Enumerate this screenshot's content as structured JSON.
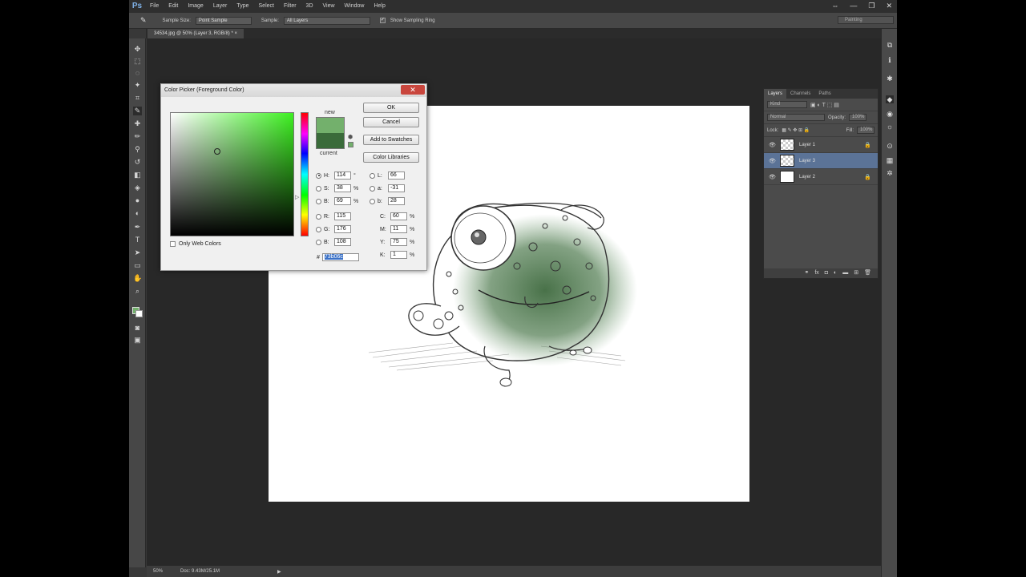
{
  "app": {
    "logo": "Ps"
  },
  "menu": [
    "File",
    "Edit",
    "Image",
    "Layer",
    "Type",
    "Select",
    "Filter",
    "3D",
    "View",
    "Window",
    "Help"
  ],
  "window_controls": [
    "⇔",
    "—",
    "❐",
    "✕"
  ],
  "options_bar": {
    "sample_size_label": "Sample Size:",
    "sample_size_value": "Point Sample",
    "sample_label": "Sample:",
    "sample_value": "All Layers",
    "show_ring_label": "Show Sampling Ring",
    "workspace": "Painting"
  },
  "document_tab": "34534.jpg @ 50% (Layer 3, RGB/8) *",
  "status": {
    "zoom": "50%",
    "doc": "Doc: 9.43M/25.1M"
  },
  "color_picker": {
    "title": "Color Picker (Foreground Color)",
    "new_label": "new",
    "current_label": "current",
    "new_color": "#73b06c",
    "current_color": "#3a6b3a",
    "buttons": {
      "ok": "OK",
      "cancel": "Cancel",
      "add_swatches": "Add to Swatches",
      "libraries": "Color Libraries"
    },
    "hsb": {
      "h": "114",
      "s": "38",
      "b": "69",
      "h_unit": "°",
      "s_unit": "%",
      "b_unit": "%"
    },
    "rgb": {
      "r": "115",
      "g": "176",
      "b": "108"
    },
    "lab": {
      "l": "66",
      "a": "-31",
      "b": "28"
    },
    "cmyk": {
      "c": "60",
      "m": "11",
      "y": "75",
      "k": "1"
    },
    "hex": "73b06c",
    "only_web": "Only Web Colors",
    "labels": {
      "h": "H:",
      "s": "S:",
      "b": "B:",
      "r": "R:",
      "g": "G:",
      "bb": "B:",
      "l": "L:",
      "a": "a:",
      "lab_b": "b:",
      "c": "C:",
      "m": "M:",
      "y": "Y:",
      "k": "K:",
      "hash": "#",
      "pct": "%"
    }
  },
  "layers_panel": {
    "tabs": [
      "Layers",
      "Channels",
      "Paths"
    ],
    "kind": "Kind",
    "blend_mode": "Normal",
    "opacity_label": "Opacity:",
    "opacity_value": "100%",
    "lock_label": "Lock:",
    "fill_label": "Fill:",
    "fill_value": "100%",
    "layers": [
      {
        "name": "Layer 1",
        "selected": false,
        "locked": true
      },
      {
        "name": "Layer 3",
        "selected": true,
        "locked": false
      },
      {
        "name": "Layer 2",
        "selected": false,
        "locked": true
      }
    ]
  }
}
